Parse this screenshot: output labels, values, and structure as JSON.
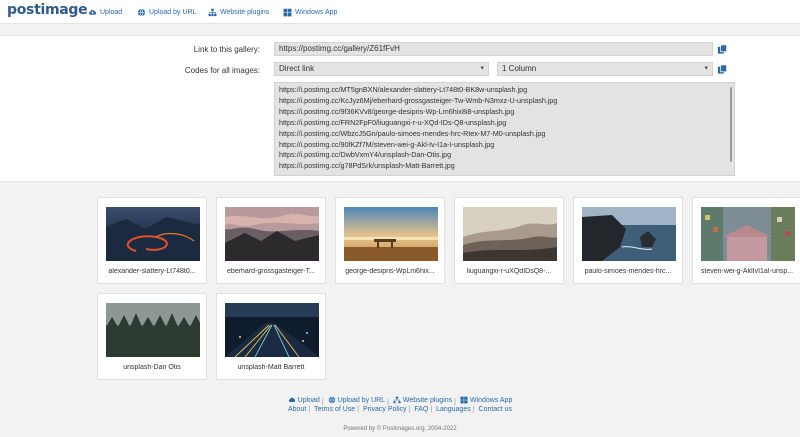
{
  "brand": {
    "logo_text": "postimage",
    "accent": "#2b6aa6"
  },
  "nav": {
    "upload": "Upload",
    "upload_by_url": "Upload by URL",
    "website_plugins": "Website plugins",
    "windows_app": "Windows App"
  },
  "gallery": {
    "link_label": "Link to this gallery:",
    "link_value": "https://postimg.cc/gallery/Z61fFvH",
    "codes_label": "Codes for all images:",
    "code_type": "Direct link",
    "columns": "1 Column",
    "codes": [
      "https://i.postimg.cc/MT5gnBXN/alexander-slattery-Lt748t0-BK8w-unsplash.jpg",
      "https://i.postimg.cc/KcJyz6Mj/eberhard-grossgasteiger-Tw-Wmb-N3mxz-U-unsplash.jpg",
      "https://i.postimg.cc/9f36KVv8/george-desipris-Wp-Lm6hix8i8-unsplash.jpg",
      "https://i.postimg.cc/FRN2FpF0/liuguangxi-r-u-XQd-IDs-Q8-unsplash.jpg",
      "https://i.postimg.cc/WbzcJ5Gn/paulo-simoes-mendes-hrc-Rtex-M7-M0-unsplash.jpg",
      "https://i.postimg.cc/90fKZf7M/steven-wei-g-Akl-Iv-I1a-I-unsplash.jpg",
      "https://i.postimg.cc/DwbVxmY4/unsplash-Dan-Otis.jpg",
      "https://i.postimg.cc/g78PdSrk/unsplash-Matt-Barrett.jpg"
    ]
  },
  "thumbnails": [
    {
      "caption": "alexander-slattery-Lt748t0..."
    },
    {
      "caption": "eberhard-grossgasteiger-T..."
    },
    {
      "caption": "george-desipris-WpLm6hix..."
    },
    {
      "caption": "liuguangxi-r-uXQdIDsQ8-..."
    },
    {
      "caption": "paulo-simoes-mendes-hrc..."
    },
    {
      "caption": "steven-wei-g-AklIvI1aI-unsp..."
    },
    {
      "caption": "unsplash-Dan Otis"
    },
    {
      "caption": "unsplash-Matt Barrett"
    }
  ],
  "footer": {
    "upload": "Upload",
    "upload_by_url": "Upload by URL",
    "website_plugins": "Website plugins",
    "windows_app": "Windows App",
    "about": "About",
    "terms": "Terms of Use",
    "privacy": "Privacy Policy",
    "faq": "FAQ",
    "languages": "Languages",
    "contact": "Contact us",
    "powered": "Powered by © Postimages.org, 2004-2022"
  }
}
